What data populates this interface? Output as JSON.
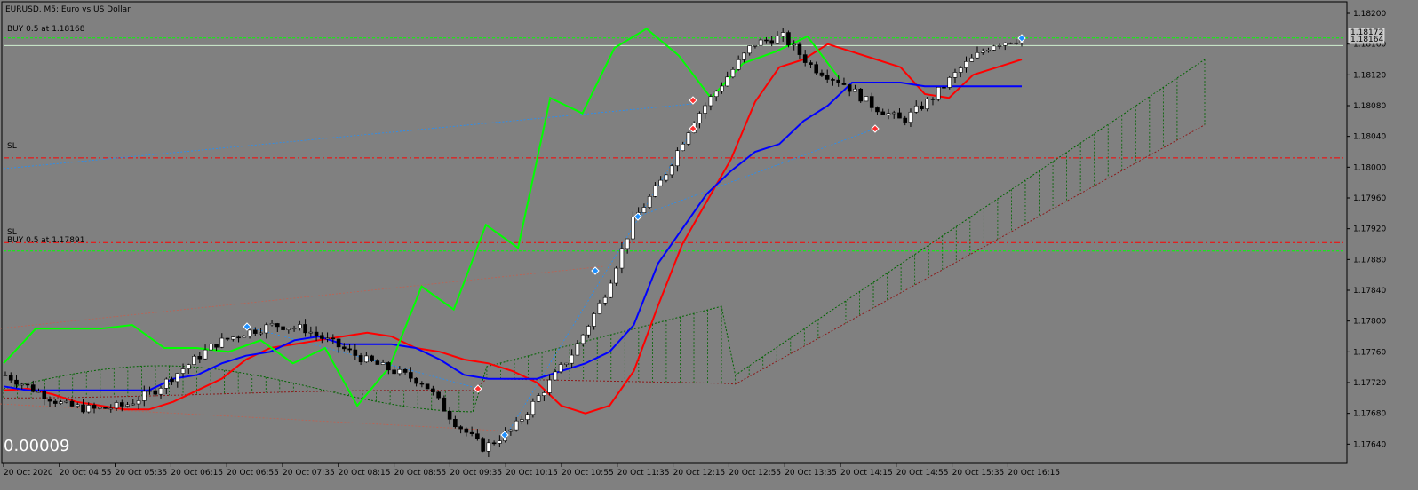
{
  "header": {
    "title": "EURUSD, M5:  Euro vs US Dollar"
  },
  "overlay": {
    "value_text": "0.00009"
  },
  "trade_labels": {
    "buy1": "BUY 0.5 at 1.18168",
    "sl1": "SL",
    "sl2": "SL",
    "buy2": "BUY 0.5 at 1.17891"
  },
  "price_tags": {
    "upper": "1.18172",
    "lower": "1.18164"
  },
  "colors": {
    "background": "#808080",
    "candle_up": "#ffffff",
    "candle_down": "#000000",
    "tenkan": "#ff0000",
    "kijun": "#0000ff",
    "chikou": "#00ff00",
    "cloud": "#006400",
    "sl_line": "#ff0000",
    "buy_line": "#00ff00",
    "trade_line": "#1e90ff"
  },
  "chart_data": {
    "type": "candlestick",
    "symbol": "EURUSD",
    "timeframe": "M5",
    "ylim": [
      1.17615,
      1.18215
    ],
    "y_ticks": [
      "1.18200",
      "1.18160",
      "1.18120",
      "1.18080",
      "1.18040",
      "1.18000",
      "1.17960",
      "1.17920",
      "1.17880",
      "1.17840",
      "1.17800",
      "1.17760",
      "1.17720",
      "1.17680",
      "1.17640"
    ],
    "x_ticks": [
      "20 Oct 2020",
      "20 Oct 04:55",
      "20 Oct 05:35",
      "20 Oct 06:15",
      "20 Oct 06:55",
      "20 Oct 07:35",
      "20 Oct 08:15",
      "20 Oct 08:55",
      "20 Oct 09:35",
      "20 Oct 10:15",
      "20 Oct 10:55",
      "20 Oct 11:35",
      "20 Oct 12:15",
      "20 Oct 12:55",
      "20 Oct 13:35",
      "20 Oct 14:15",
      "20 Oct 14:55",
      "20 Oct 15:35",
      "20 Oct 16:15"
    ],
    "horizontal_levels": [
      {
        "name": "buy-level-1",
        "price": 1.18168
      },
      {
        "name": "sl-level-1",
        "price": 1.18012
      },
      {
        "name": "sl-level-2",
        "price": 1.17902
      },
      {
        "name": "buy-level-2",
        "price": 1.17891
      }
    ],
    "candles_summary": {
      "first_close": 1.1773,
      "low": 1.17625,
      "high": 1.18195,
      "last_close": 1.18168
    },
    "series": [
      {
        "name": "tenkan",
        "values": [
          1.1771,
          1.17712,
          1.17705,
          1.17695,
          1.1769,
          1.17685,
          1.17685,
          1.17695,
          1.1771,
          1.17725,
          1.1775,
          1.17765,
          1.1777,
          1.17775,
          1.1778,
          1.17785,
          1.1778,
          1.17765,
          1.1776,
          1.1775,
          1.17745,
          1.17735,
          1.1772,
          1.1769,
          1.1768,
          1.1769,
          1.17735,
          1.1782,
          1.179,
          1.17955,
          1.1801,
          1.18085,
          1.1813,
          1.1814,
          1.1816,
          1.1815,
          1.1814,
          1.1813,
          1.18095,
          1.1809,
          1.1812,
          1.1813,
          1.1814
        ]
      },
      {
        "name": "kijun",
        "values": [
          1.17715,
          1.1771,
          1.1771,
          1.1771,
          1.1771,
          1.1771,
          1.1771,
          1.17725,
          1.1773,
          1.17745,
          1.17755,
          1.1776,
          1.17775,
          1.1778,
          1.1777,
          1.1777,
          1.1777,
          1.17765,
          1.1775,
          1.1773,
          1.17725,
          1.17725,
          1.17725,
          1.17735,
          1.17745,
          1.1776,
          1.17795,
          1.17875,
          1.1792,
          1.17965,
          1.17995,
          1.1802,
          1.1803,
          1.1806,
          1.1808,
          1.1811,
          1.1811,
          1.1811,
          1.18105,
          1.18105,
          1.18105,
          1.18105,
          1.18105
        ]
      },
      {
        "name": "chikou",
        "values": [
          1.17745,
          1.1779,
          1.1779,
          1.1779,
          1.17795,
          1.17765,
          1.17765,
          1.1776,
          1.17775,
          1.17745,
          1.17765,
          1.1769,
          1.1774,
          1.17845,
          1.17815,
          1.17925,
          1.17895,
          1.1809,
          1.1807,
          1.18155,
          1.1818,
          1.18145,
          1.1809,
          1.18135,
          1.1815,
          1.1817,
          1.18115
        ]
      }
    ]
  }
}
